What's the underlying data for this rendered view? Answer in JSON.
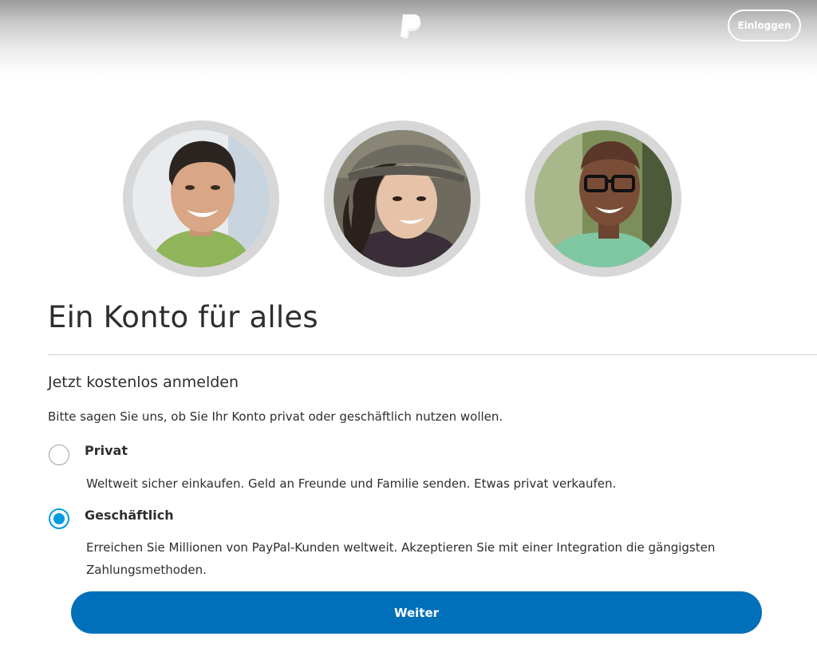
{
  "header": {
    "logo": "paypal-logo",
    "login_label": "Einloggen"
  },
  "avatars": [
    "smiling-man-portrait",
    "smiling-woman-with-hat-portrait",
    "smiling-man-with-glasses-portrait"
  ],
  "main": {
    "title": "Ein Konto für alles",
    "subtitle": "Jetzt kostenlos anmelden",
    "prompt": "Bitte sagen Sie uns, ob Sie Ihr Konto privat oder geschäftlich nutzen wollen."
  },
  "options": [
    {
      "label": "Privat",
      "description": "Weltweit sicher einkaufen. Geld an Freunde und Familie senden. Etwas privat verkaufen.",
      "selected": false
    },
    {
      "label": "Geschäftlich",
      "description_line1": "Erreichen Sie Millionen von PayPal-Kunden weltweit. Akzeptieren Sie mit einer Integration die gängigsten",
      "description_line2": "Zahlungsmethoden.",
      "selected": true
    }
  ],
  "continue_label": "Weiter",
  "colors": {
    "primary_button": "#0070ba",
    "radio_selected": "#009cde",
    "avatar_ring": "#d7d7d7"
  }
}
